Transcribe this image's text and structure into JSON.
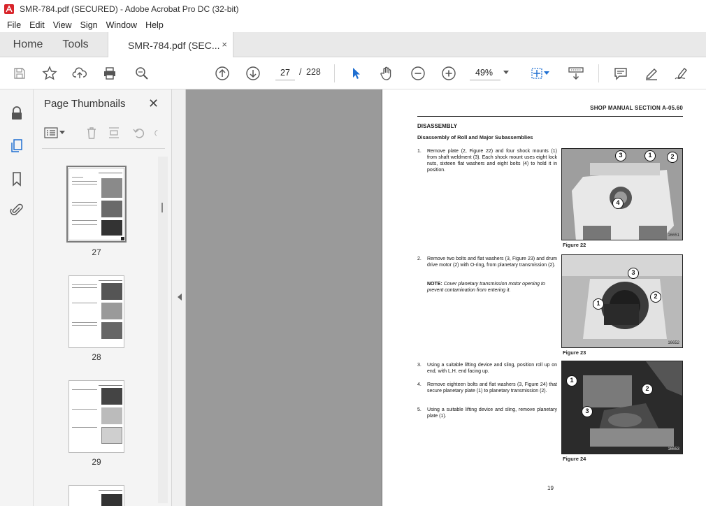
{
  "window": {
    "title": "SMR-784.pdf (SECURED) - Adobe Acrobat Pro DC (32-bit)",
    "accent": "#d8242a"
  },
  "menu": [
    "File",
    "Edit",
    "View",
    "Sign",
    "Window",
    "Help"
  ],
  "tabs": {
    "home": "Home",
    "tools": "Tools",
    "document": "SMR-784.pdf (SEC...",
    "close": "×"
  },
  "toolbar": {
    "current_page": "27",
    "separator": "/",
    "total_pages": "228",
    "zoom": "49%",
    "icons": [
      "save-icon",
      "bookmark-star-icon",
      "upload-icon",
      "print-icon",
      "zoom-search-icon",
      "page-up-icon",
      "page-down-icon",
      "select-cursor-icon",
      "hand-icon",
      "zoom-out-icon",
      "zoom-in-icon",
      "fit-page-icon",
      "scroll-mode-icon",
      "comment-icon",
      "highlight-icon",
      "sign-icon"
    ]
  },
  "panel": {
    "title": "Page Thumbnails",
    "close": "✕",
    "thumbnails": [
      {
        "label": "27",
        "selected": true
      },
      {
        "label": "28",
        "selected": false
      },
      {
        "label": "29",
        "selected": false
      }
    ]
  },
  "page": {
    "header": "SHOP MANUAL SECTION A-05.60",
    "section": "DISASSEMBLY",
    "subsection": "Disassembly of Roll and Major Subassemblies",
    "steps": [
      {
        "num": "1.",
        "text": "Remove plate (2, Figure 22) and four shock mounts (1) from shaft weldment (3). Each shock mount uses eight lock nuts, sixteen flat washers and eight bolts (4) to hold it in position."
      },
      {
        "num": "2.",
        "text": "Remove two bolts and flat washers (3, Figure 23) and drum drive motor (2) with O-ring, from planetary transmission (2)."
      },
      {
        "num": "3.",
        "text": "Using a suitable lifting device and sling, position roll up on end, with L.H. end facing up."
      },
      {
        "num": "4.",
        "text": "Remove eighteen bolts and flat washers (3, Figure 24) that secure planetary plate (1) to planetary transmission (2)."
      },
      {
        "num": "5.",
        "text": "Using a suitable lifting device and sling, remove planetary plate (1)."
      }
    ],
    "note": {
      "label": "NOTE:",
      "text": "Cover planetary transmission motor opening to prevent contamination from entering it."
    },
    "figures": [
      {
        "caption": "Figure 22",
        "code": "16651",
        "callouts": [
          "3",
          "1",
          "2",
          "4"
        ]
      },
      {
        "caption": "Figure 23",
        "code": "16652",
        "callouts": [
          "3",
          "1",
          "2"
        ]
      },
      {
        "caption": "Figure 24",
        "code": "16653",
        "callouts": [
          "1",
          "2",
          "3"
        ]
      }
    ],
    "page_number": "19"
  }
}
